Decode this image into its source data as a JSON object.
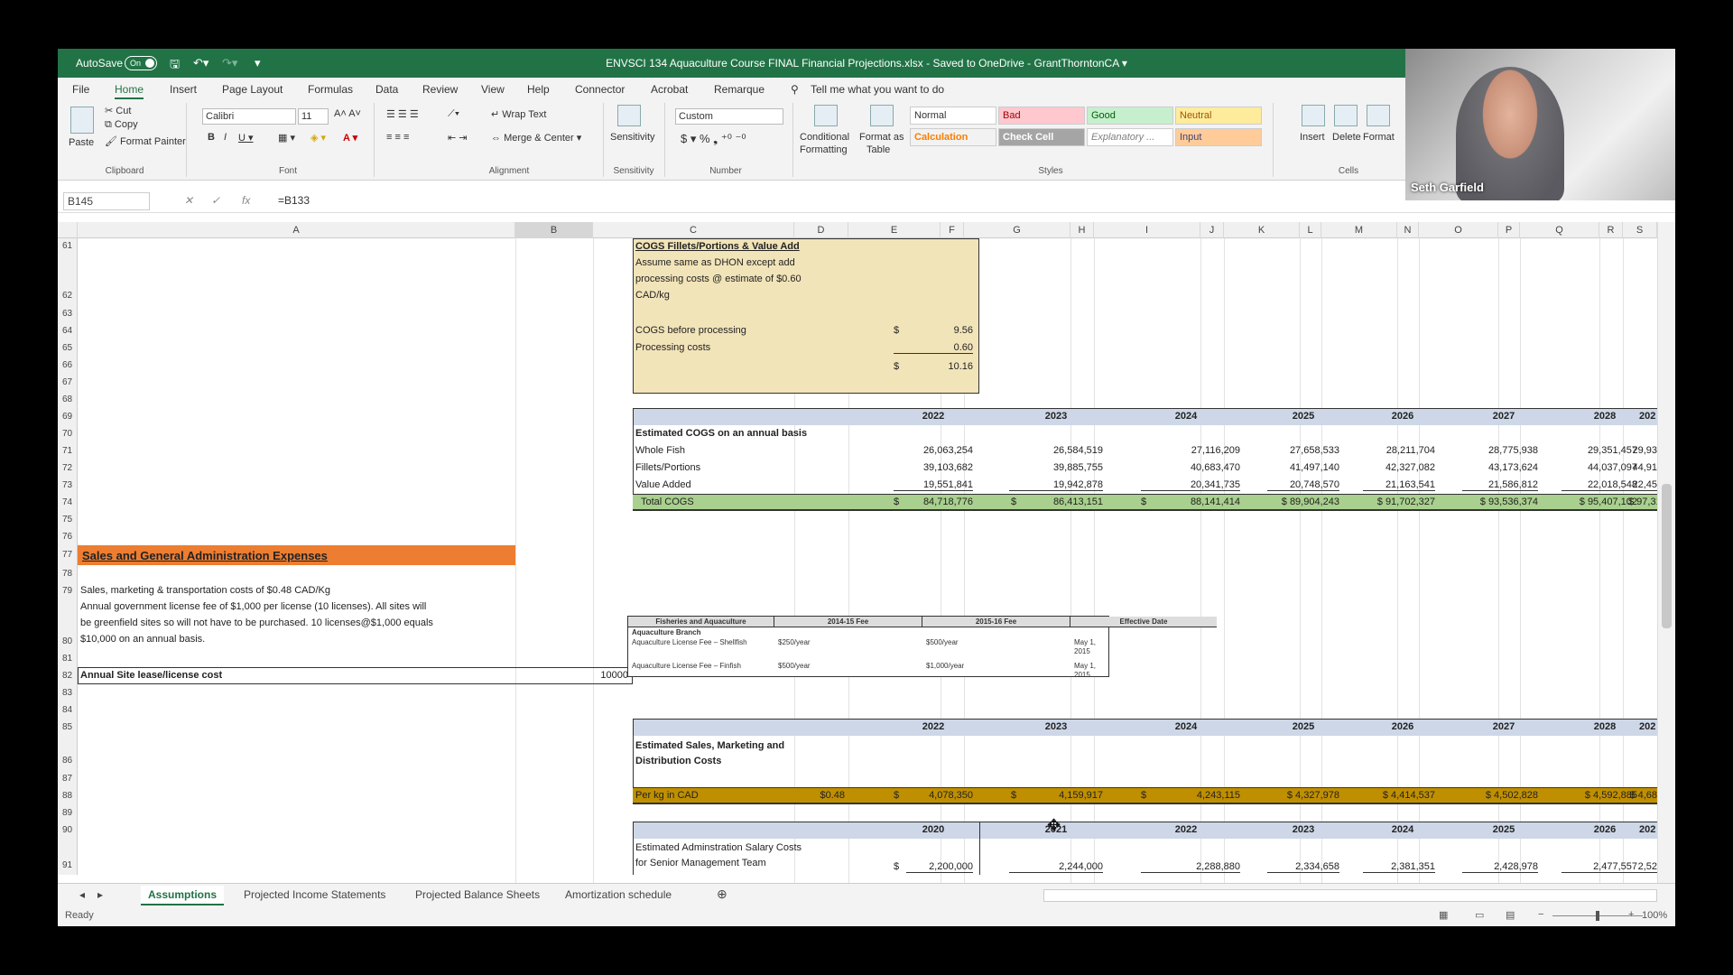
{
  "titlebar": {
    "autosave": "AutoSave",
    "toggle": "On",
    "doc_title": "ENVSCI 134 Aquaculture Course FINAL Financial Projections.xlsx  -  Saved to OneDrive - GrantThorntonCA  ▾"
  },
  "menu": [
    "File",
    "Home",
    "Insert",
    "Page Layout",
    "Formulas",
    "Data",
    "Review",
    "View",
    "Help",
    "Connector",
    "Acrobat",
    "Remarque"
  ],
  "tell_me": "Tell me what you want to do",
  "ribbon": {
    "paste": "Paste",
    "cut": "Cut",
    "copy": "Copy",
    "format_painter": "Format Painter",
    "clipboard": "Clipboard",
    "font_name": "Calibri",
    "font_size": "11",
    "font": "Font",
    "wrap_text": "Wrap Text",
    "merge_center": "Merge & Center",
    "alignment": "Alignment",
    "sensitivity": "Sensitivity",
    "sensitivity_grp": "Sensitivity",
    "number_format": "Custom",
    "number": "Number",
    "cond_format": "Conditional",
    "cond_format2": "Formatting",
    "format_table": "Format as",
    "format_table2": "Table",
    "styles": [
      "Normal",
      "Bad",
      "Good",
      "Neutral",
      "Calculation",
      "Check Cell",
      "Explanatory ...",
      "Input"
    ],
    "styles_grp": "Styles",
    "insert": "Insert",
    "delete": "Delete",
    "format": "Format",
    "cells": "Cells"
  },
  "formula_bar": {
    "name_box": "B145",
    "formula": "=B133"
  },
  "columns": [
    "A",
    "B",
    "C",
    "D",
    "E",
    "F",
    "G",
    "H",
    "I",
    "J",
    "K",
    "L",
    "M",
    "N",
    "O",
    "P",
    "Q",
    "R",
    "S"
  ],
  "rows": [
    "61",
    "62",
    "63",
    "64",
    "65",
    "66",
    "67",
    "68",
    "69",
    "70",
    "71",
    "72",
    "73",
    "74",
    "75",
    "76",
    "77",
    "78",
    "79",
    "80",
    "81",
    "82",
    "83",
    "84",
    "85",
    "86",
    "87",
    "88",
    "89",
    "90",
    "91"
  ],
  "cogs_box": {
    "title": "COGS Fillets/Portions & Value Add",
    "desc1": "Assume same as DHON except add",
    "desc2": "processing costs @ estimate of $0.60",
    "desc3": "CAD/kg",
    "before_label": "COGS before processing",
    "before_cur": "$",
    "before_val": "9.56",
    "proc_label": "Processing costs",
    "proc_val": "0.60",
    "total_cur": "$",
    "total_val": "10.16"
  },
  "years_a": [
    "2022",
    "2023",
    "2024",
    "2025",
    "2026",
    "2027",
    "2028",
    "202"
  ],
  "cogs_table": {
    "header": "Estimated COGS on an annual basis",
    "rows": [
      {
        "label": "Whole Fish",
        "vals": [
          "26,063,254",
          "26,584,519",
          "27,116,209",
          "27,658,533",
          "28,211,704",
          "28,775,938",
          "29,351,457",
          "29,93"
        ]
      },
      {
        "label": "Fillets/Portions",
        "vals": [
          "39,103,682",
          "39,885,755",
          "40,683,470",
          "41,497,140",
          "42,327,082",
          "43,173,624",
          "44,037,097",
          "44,91"
        ]
      },
      {
        "label": "Value Added",
        "vals": [
          "19,551,841",
          "19,942,878",
          "20,341,735",
          "20,748,570",
          "21,163,541",
          "21,586,812",
          "22,018,548",
          "22,45"
        ]
      }
    ],
    "total_label": "Total COGS",
    "total_vals": [
      "$",
      "84,718,776",
      "$",
      "86,413,151",
      "$",
      "88,141,414",
      "$ 89,904,243",
      "$ 91,702,327",
      "$ 93,536,374",
      "$ 95,407,102",
      "$ 97,31"
    ]
  },
  "sga": {
    "title": "Sales and General Administration Expenses",
    "l1": "Sales, marketing & transportation costs of $0.48 CAD/Kg",
    "l2": "Annual government license fee of $1,000 per license (10 licenses). All sites will",
    "l3": "be greenfield sites so will not have to be purchased. 10 licenses@$1,000 equals",
    "l4": "$10,000 on an annual basis.",
    "lease_label": "Annual Site lease/license cost",
    "lease_val": "10000"
  },
  "fee_table": {
    "headers": [
      "Fisheries and Aquaculture",
      "2014-15 Fee",
      "2015-16 Fee",
      "Effective Date"
    ],
    "branch": "Aquaculture Branch",
    "r1": [
      "Aquaculture License Fee – Shellfish",
      "$250/year",
      "$500/year",
      "May 1, 2015"
    ],
    "r2": [
      "Aquaculture License Fee – Finfish",
      "$500/year",
      "$1,000/year",
      "May 1, 2015"
    ]
  },
  "smd": {
    "header1": "Estimated Sales, Marketing and",
    "header2": "Distribution Costs",
    "per_kg_label": "Per kg in CAD",
    "per_kg_rate": "$0.48",
    "vals": [
      "$",
      "4,078,350",
      "$",
      "4,159,917",
      "$",
      "4,243,115",
      "$ 4,327,978",
      "$ 4,414,537",
      "$ 4,502,828",
      "$ 4,592,885",
      "$ 4,68"
    ]
  },
  "years_b": [
    "2020",
    "2021",
    "2022",
    "2023",
    "2024",
    "2025",
    "2026",
    "202"
  ],
  "admin": {
    "l1": "Estimated Adminstration Salary Costs",
    "l2": "for Senior Management Team",
    "vals": [
      "$",
      "2,200,000",
      "2,244,000",
      "2,288,880",
      "2,334,658",
      "2,381,351",
      "2,428,978",
      "2,477,557",
      "2,52"
    ]
  },
  "sheets": [
    "Assumptions",
    "Projected Income Statements",
    "Projected Balance Sheets",
    "Amortization schedule"
  ],
  "status": "Ready",
  "zoom": "100%",
  "webcam_name": "Seth Garfield"
}
